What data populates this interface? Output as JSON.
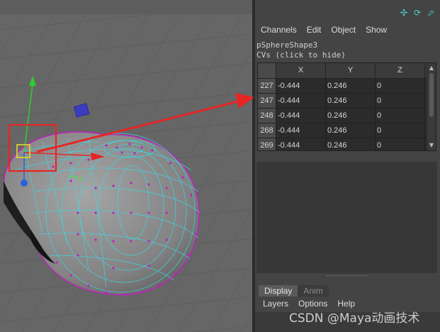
{
  "panel": {
    "menu": [
      "Channels",
      "Edit",
      "Object",
      "Show"
    ],
    "shape_name": "pSphereShape3",
    "cv_caption": "CVs (click to hide)",
    "table": {
      "columns": [
        "X",
        "Y",
        "Z"
      ],
      "rows": [
        {
          "id": "227",
          "x": "-0.444",
          "y": "0.246",
          "z": "0"
        },
        {
          "id": "247",
          "x": "-0.444",
          "y": "0.246",
          "z": "0"
        },
        {
          "id": "248",
          "x": "-0.444",
          "y": "0.246",
          "z": "0"
        },
        {
          "id": "268",
          "x": "-0.444",
          "y": "0.246",
          "z": "0"
        },
        {
          "id": "269",
          "x": "-0.444",
          "y": "0.246",
          "z": "0"
        }
      ]
    },
    "tool_icons": [
      "axes-icon",
      "refresh-icon",
      "external-icon"
    ]
  },
  "layer_panel": {
    "tabs": {
      "display": "Display",
      "anim": "Anim"
    },
    "menu": [
      "Layers",
      "Options",
      "Help"
    ]
  },
  "watermark": "CSDN @Maya动画技术",
  "colors": {
    "annotation_red": "#e82525",
    "wireframe_cyan": "#39d9e6",
    "cv_magenta": "#c020c0",
    "mesh_gray": "#8a8a8a"
  }
}
